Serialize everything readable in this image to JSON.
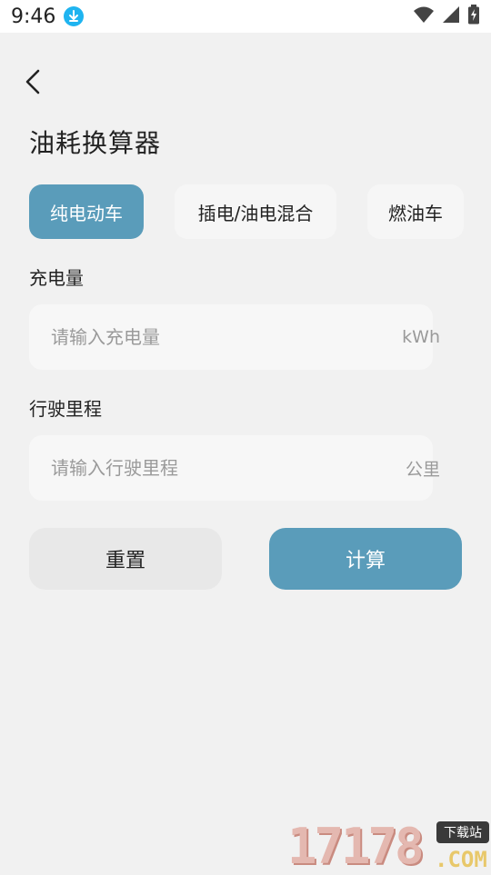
{
  "status_bar": {
    "time": "9:46",
    "icons": [
      "download-icon",
      "wifi-icon",
      "signal-icon",
      "battery-icon"
    ]
  },
  "header": {
    "back_icon": "chevron-left-icon",
    "title": "油耗换算器"
  },
  "tabs": [
    {
      "label": "纯电动车",
      "active": true
    },
    {
      "label": "插电/油电混合",
      "active": false
    },
    {
      "label": "燃油车",
      "active": false
    }
  ],
  "fields": {
    "charge": {
      "label": "充电量",
      "placeholder": "请输入充电量",
      "value": "",
      "unit": "kWh"
    },
    "distance": {
      "label": "行驶里程",
      "placeholder": "请输入行驶里程",
      "value": "",
      "unit": "公里"
    }
  },
  "buttons": {
    "reset_label": "重置",
    "calculate_label": "计算"
  },
  "colors": {
    "accent": "#5a9cba",
    "background": "#f1f1f1",
    "input_bg": "#f7f7f7",
    "reset_bg": "#e8e8e8"
  },
  "watermark": {
    "digits": "17178",
    "domain": ".COM",
    "tag": "下载站"
  }
}
